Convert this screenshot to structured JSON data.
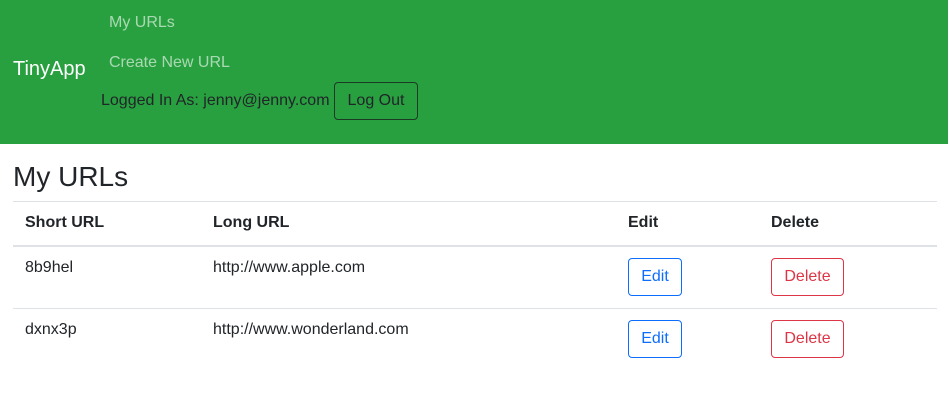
{
  "navbar": {
    "brand": "TinyApp",
    "links": [
      "My URLs",
      "Create New URL"
    ],
    "logged_in_text": "Logged In As: jenny@jenny.com",
    "logout_label": "Log Out",
    "background": "#28a03f"
  },
  "main": {
    "title": "My URLs",
    "table": {
      "headers": [
        "Short URL",
        "Long URL",
        "Edit",
        "Delete"
      ],
      "rows": [
        {
          "short": "8b9hel",
          "long": "http://www.apple.com",
          "edit_label": "Edit",
          "delete_label": "Delete"
        },
        {
          "short": "dxnx3p",
          "long": "http://www.wonderland.com",
          "edit_label": "Edit",
          "delete_label": "Delete"
        }
      ]
    }
  },
  "colors": {
    "edit_accent": "#0d6efd",
    "delete_accent": "#dc3545"
  }
}
